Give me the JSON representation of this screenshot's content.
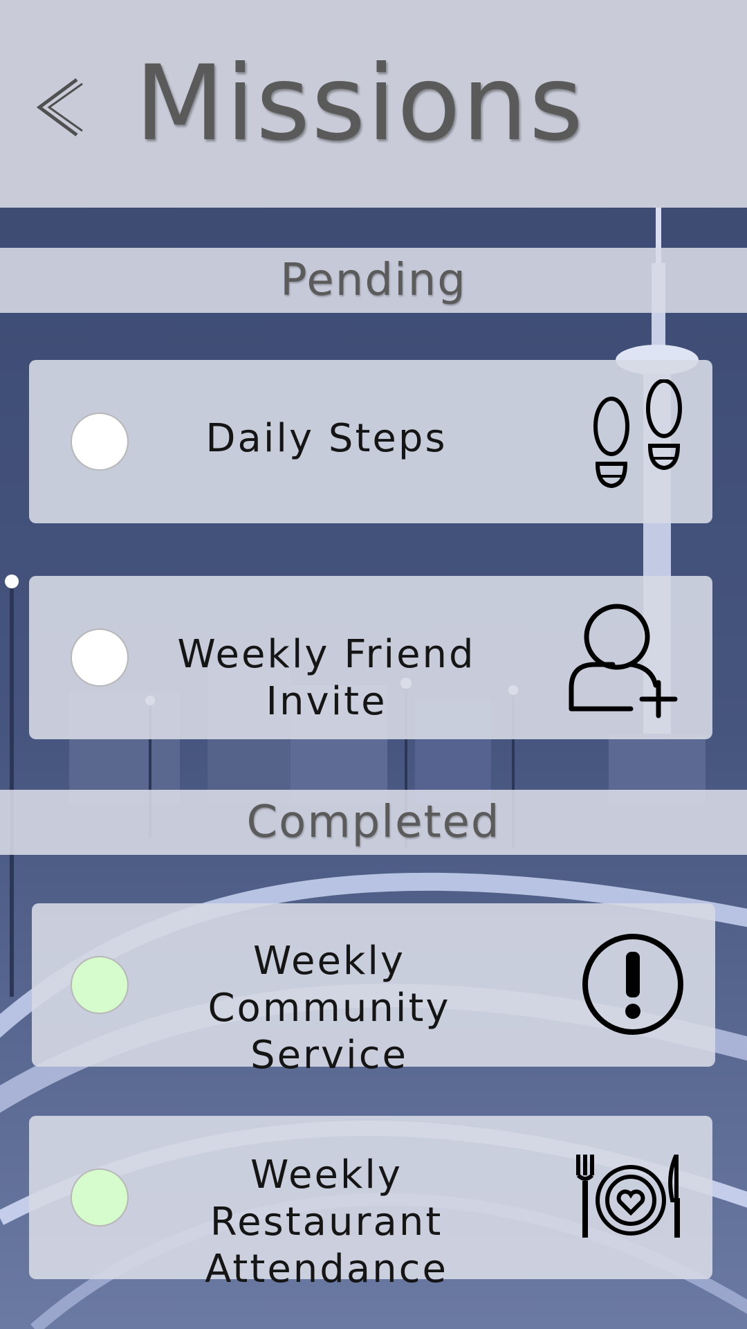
{
  "header": {
    "title": "Missions"
  },
  "sections": {
    "pending_label": "Pending",
    "completed_label": "Completed"
  },
  "missions": {
    "pending": [
      {
        "label": "Daily  Steps",
        "icon": "footsteps-icon",
        "status": "pending"
      },
      {
        "label": "Weekly  Friend  Invite",
        "icon": "add-friend-icon",
        "status": "pending"
      }
    ],
    "completed": [
      {
        "label": "Weekly  Community\nService",
        "icon": "exclamation-circle-icon",
        "status": "completed"
      },
      {
        "label": "Weekly  Restaurant\nAttendance",
        "icon": "restaurant-plate-icon",
        "status": "completed"
      }
    ]
  },
  "colors": {
    "header_bg": "#c9ccd8",
    "page_bg": "#3d4b70",
    "pending_check": "#ffffff",
    "completed_check": "#d6fbcc"
  }
}
